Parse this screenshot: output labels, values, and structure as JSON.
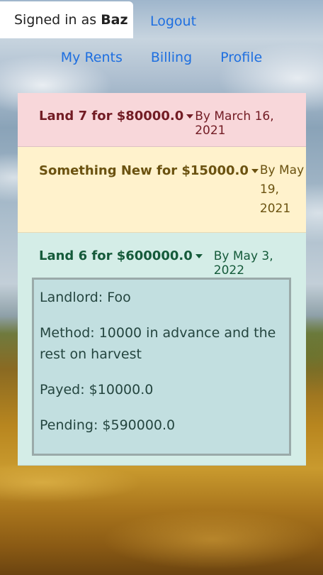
{
  "header": {
    "signed_in_prefix": "Signed in as",
    "username": "Baz",
    "logout_label": "Logout"
  },
  "nav": {
    "items": [
      {
        "label": "My Rents"
      },
      {
        "label": "Billing"
      },
      {
        "label": "Profile"
      }
    ]
  },
  "rents": [
    {
      "title": "Land 7 for $80000.0",
      "date_line1": "By March 16, 2021"
    },
    {
      "title": "Something New for $15000.0",
      "date_line1": "By May",
      "date_line2": "19,",
      "date_line3": "2021"
    },
    {
      "title": "Land 6 for $600000.0",
      "date_line1": "By May 3, 2022",
      "details": {
        "landlord": "Landlord: Foo",
        "method": "Method: 10000 in advance and the rest on harvest",
        "payed": "Payed: $10000.0",
        "pending": "Pending: $590000.0"
      }
    }
  ],
  "colors": {
    "link": "#1e6fe0",
    "danger_bg": "#f8d7da",
    "warning_bg": "#fff2cc",
    "success_bg": "#d4ede7",
    "detail_bg": "#c2dfe0"
  },
  "icons": {
    "dropdown": "caret-down-icon"
  }
}
